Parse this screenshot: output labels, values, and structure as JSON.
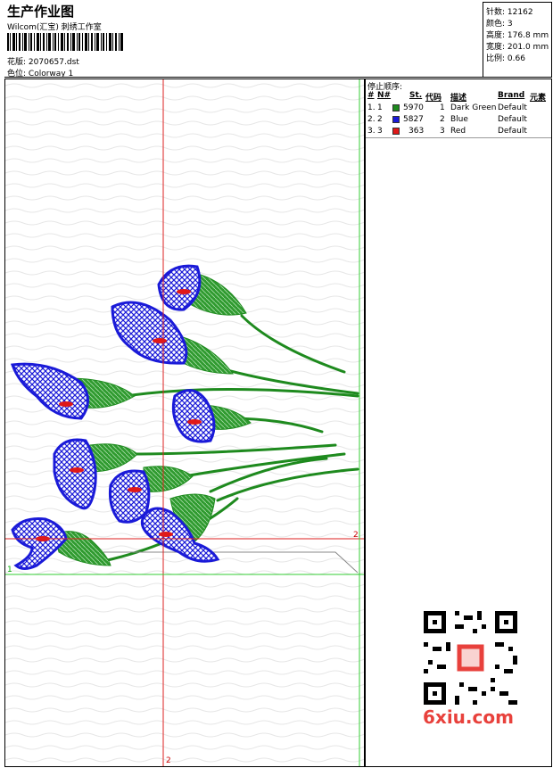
{
  "header": {
    "title": "生产作业图",
    "subtitle": "Wilcom(汇宝) 刺绣工作室",
    "design_label": "花版:",
    "design_value": "2070657.dst",
    "colorway_label": "色位:",
    "colorway_value": "Colorway 1"
  },
  "stats": [
    {
      "label": "针数:",
      "value": "12162"
    },
    {
      "label": "颜色:",
      "value": "3"
    },
    {
      "label": "高度:",
      "value": "176.8 mm"
    },
    {
      "label": "宽度:",
      "value": "201.0 mm"
    },
    {
      "label": "比例:",
      "value": "0.66"
    }
  ],
  "stop_sequence": {
    "title": "停止顺序:",
    "columns": [
      "#",
      "N#",
      "St.",
      "代码",
      "描述",
      "Brand",
      "元素"
    ],
    "rows": [
      {
        "idx": "1.",
        "n": "1",
        "color": "#1e8a1e",
        "st": "5970",
        "code": "1",
        "desc": "Dark Green",
        "brand": "Default"
      },
      {
        "idx": "2.",
        "n": "2",
        "color": "#1a1ad8",
        "st": "5827",
        "code": "2",
        "desc": "Blue",
        "brand": "Default"
      },
      {
        "idx": "3.",
        "n": "3",
        "color": "#e01818",
        "st": "363",
        "code": "3",
        "desc": "Red",
        "brand": "Default"
      }
    ]
  },
  "guides": {
    "h_red": "2",
    "v_red": "2",
    "h_green": "1"
  },
  "watermark": "6xiu.com",
  "colors": {
    "green": "#1e8a1e",
    "blue": "#1a1ad8",
    "red": "#e01818",
    "guide_green": "#33cc33",
    "guide_red": "#dd2222"
  }
}
